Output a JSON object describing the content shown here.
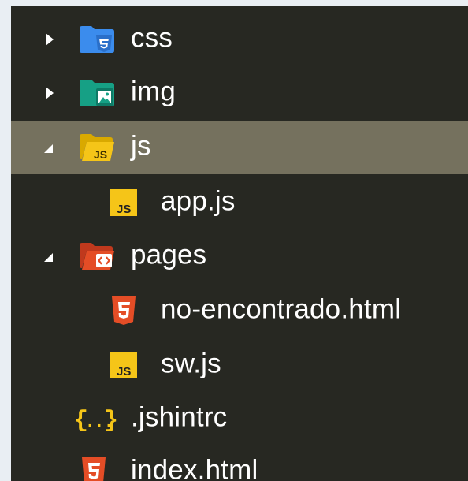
{
  "tree": {
    "items": [
      {
        "label": "css",
        "type": "folder",
        "state": "collapsed",
        "icon": "css-folder-icon"
      },
      {
        "label": "img",
        "type": "folder",
        "state": "collapsed",
        "icon": "image-folder-icon"
      },
      {
        "label": "js",
        "type": "folder",
        "state": "expanded",
        "icon": "js-folder-icon",
        "selected": true
      },
      {
        "label": "app.js",
        "type": "file",
        "icon": "js-file-icon"
      },
      {
        "label": "pages",
        "type": "folder",
        "state": "expanded",
        "icon": "html-folder-icon"
      },
      {
        "label": "no-encontrado.html",
        "type": "file",
        "icon": "html5-file-icon"
      },
      {
        "label": "sw.js",
        "type": "file",
        "icon": "js-file-icon"
      },
      {
        "label": ".jshintrc",
        "type": "file",
        "icon": "json-braces-icon"
      },
      {
        "label": "index.html",
        "type": "file",
        "icon": "html5-file-icon"
      }
    ]
  },
  "colors": {
    "background": "#272822",
    "selection": "#75715e",
    "text": "#ffffff",
    "css_blue": "#3b8ced",
    "img_teal": "#16a085",
    "js_yellow": "#f5c518",
    "html_orange": "#e44d26"
  }
}
